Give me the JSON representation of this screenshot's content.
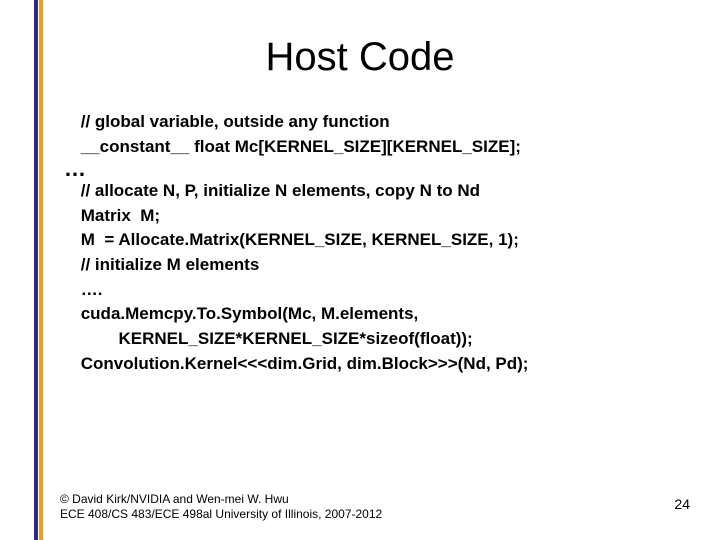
{
  "title": "Host Code",
  "code": {
    "l1": " // global variable, outside any function",
    "l2": " __constant__ float Mc[KERNEL_SIZE][KERNEL_SIZE];",
    "l3": "…",
    "l4": " // allocate N, P, initialize N elements, copy N to Nd",
    "l5": " Matrix  M;",
    "l6": " M  = Allocate.Matrix(KERNEL_SIZE, KERNEL_SIZE, 1);",
    "l7": " // initialize M elements",
    "l8": " ….",
    "l9": " cuda.Memcpy.To.Symbol(Mc, M.elements, ",
    "l10": "         KERNEL_SIZE*KERNEL_SIZE*sizeof(float));",
    "l11": " Convolution.Kernel<<<dim.Grid, dim.Block>>>(Nd, Pd);"
  },
  "footer": {
    "line1": "© David Kirk/NVIDIA and Wen-mei W. Hwu",
    "line2": "ECE 408/CS 483/ECE 498al University of Illinois, 2007-2012"
  },
  "page_number": "24",
  "colors": {
    "accent_blue": "#2a2a8a",
    "accent_orange": "#e7a021"
  }
}
